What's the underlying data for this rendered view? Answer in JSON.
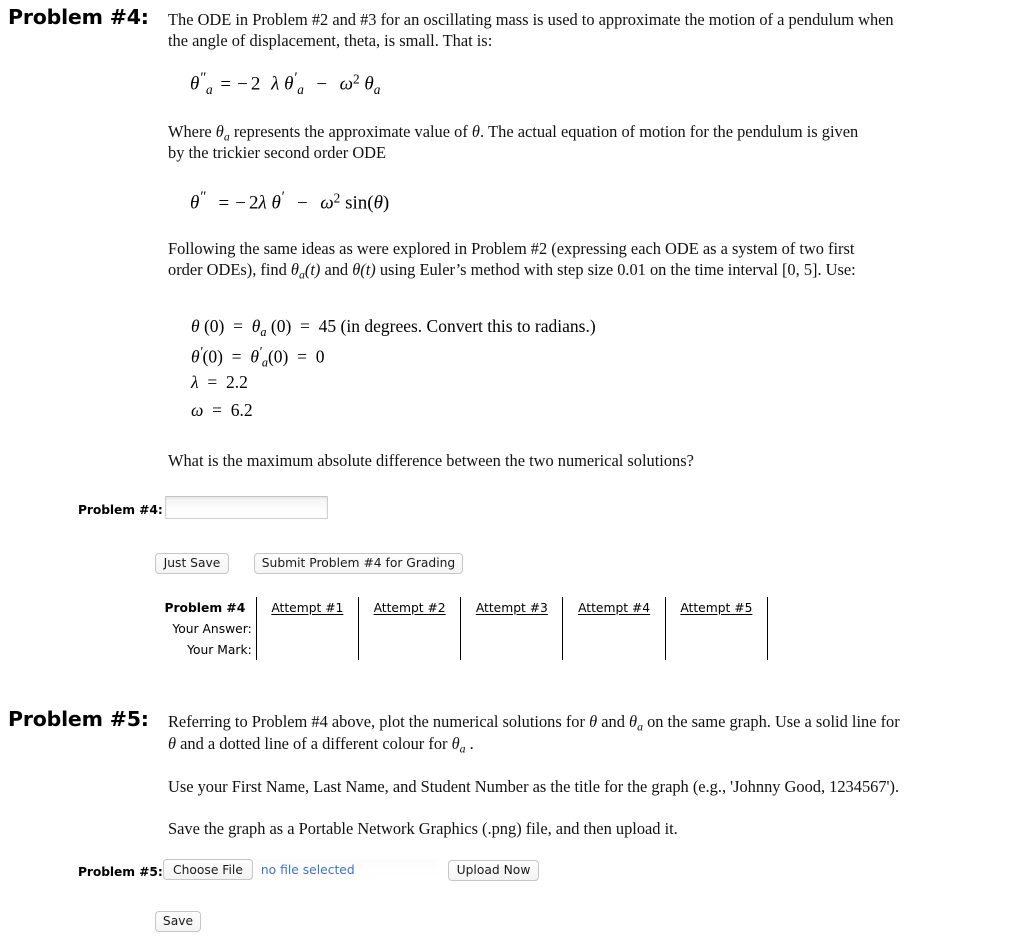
{
  "problem4": {
    "label": "Problem #4:",
    "intro_line1": "The ODE in Problem #2 and #3 for an oscillating mass is used to approximate the motion of a pendulum when",
    "intro_line2": "the angle of displacement, theta, is small. That is:",
    "equation_approx": {
      "lhs_var": "θ",
      "lhs_primes": "″",
      "lhs_sub": "a",
      "equals": "=",
      "rhs": "− 2 λ θ′a − ω² θa",
      "plain": "θ″a = −2λθ′a − ω²θa"
    },
    "where_line1_a": "Where ",
    "where_line1_theta_a": "θa",
    "where_line1_b": " represents the approximate value of ",
    "where_line1_theta": "θ",
    "where_line1_c": ". The actual equation of motion for the pendulum is given",
    "where_line2": "by the trickier second order ODE",
    "equation_exact": {
      "plain": "θ″ = −2λθ′ − ω² sin(θ)"
    },
    "following_line1": "Following the same ideas as were explored in Problem #2 (expressing each ODE as a system of two first",
    "following_line2_a": "order ODEs), find ",
    "following_line2_thetaa": "θa(t)",
    "following_line2_b": " and ",
    "following_line2_theta": "θ(t)",
    "following_line2_c": " using Euler’s method with step size 0.01 on the time interval [0, 5]. Use:",
    "initial_conditions": [
      "θ (0)  =  θa (0)  =  45 (in degrees. Convert this to radians.)",
      "θ ′(0)  =  θ′a (0)  =  0",
      "λ  =  2.2",
      "ω  =  6.2"
    ],
    "question": "What is the maximum absolute difference between the two numerical solutions?",
    "answer_field_label": "Problem #4:",
    "answer_field_value": "",
    "answer_field_placeholder": "",
    "just_save_label": "Just Save",
    "submit_label": "Submit Problem #4 for Grading",
    "attempts_table": {
      "row_labels": [
        "Problem #4",
        "Your Answer:",
        "Your Mark:"
      ],
      "columns": [
        "Attempt #1",
        "Attempt #2",
        "Attempt #3",
        "Attempt #4",
        "Attempt #5"
      ],
      "your_answer_values": [
        "",
        "",
        "",
        "",
        ""
      ],
      "your_mark_values": [
        "",
        "",
        "",
        "",
        ""
      ]
    }
  },
  "problem5": {
    "label": "Problem #5:",
    "para1_a": "Referring to Problem #4 above, plot the numerical solutions for ",
    "para1_theta": "θ",
    "para1_b": " and ",
    "para1_theta_a": "θa",
    "para1_c": " on the same graph. Use a solid line for",
    "para1_line2_a": "θ",
    "para1_line2_b": " and a dotted line of a different colour for ",
    "para1_line2_theta_a": "θa",
    "para1_line2_c": " .",
    "para2": "Use your First Name, Last Name, and Student Number as the title for the graph (e.g., 'Johnny Good, 1234567').",
    "para3": "Save the graph as a Portable Network Graphics (.png) file, and then upload it.",
    "upload_field_label": "Problem #5:",
    "choose_file_label": "Choose File",
    "file_status": "no file selected",
    "upload_now_label": "Upload Now",
    "save_label": "Save"
  },
  "colors": {
    "text": "#000000",
    "link_blue": "#3b6fd4",
    "button_border": "#c6c6c6",
    "table_border": "#000000",
    "table_outer_border": "#a8a8a8"
  }
}
